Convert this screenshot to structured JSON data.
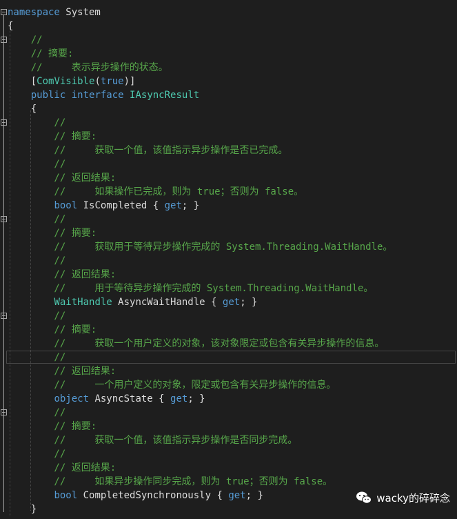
{
  "lines": [
    [
      {
        "t": "namespace",
        "c": "kw"
      },
      {
        "t": " System",
        "c": "pl"
      }
    ],
    [
      {
        "t": "{",
        "c": "pl"
      }
    ],
    [
      {
        "t": "    //",
        "c": "cm"
      }
    ],
    [
      {
        "t": "    // 摘要:",
        "c": "cm"
      }
    ],
    [
      {
        "t": "    //     表示异步操作的状态。",
        "c": "cm"
      }
    ],
    [
      {
        "t": "    [",
        "c": "pl"
      },
      {
        "t": "ComVisible",
        "c": "ty"
      },
      {
        "t": "(",
        "c": "pl"
      },
      {
        "t": "true",
        "c": "kw"
      },
      {
        "t": ")]",
        "c": "pl"
      }
    ],
    [
      {
        "t": "    ",
        "c": "pl"
      },
      {
        "t": "public",
        "c": "kw"
      },
      {
        "t": " ",
        "c": "pl"
      },
      {
        "t": "interface",
        "c": "kw"
      },
      {
        "t": " ",
        "c": "pl"
      },
      {
        "t": "IAsyncResult",
        "c": "ty"
      }
    ],
    [
      {
        "t": "    {",
        "c": "pl"
      }
    ],
    [
      {
        "t": "        //",
        "c": "cm"
      }
    ],
    [
      {
        "t": "        // 摘要:",
        "c": "cm"
      }
    ],
    [
      {
        "t": "        //     获取一个值，该值指示异步操作是否已完成。",
        "c": "cm"
      }
    ],
    [
      {
        "t": "        //",
        "c": "cm"
      }
    ],
    [
      {
        "t": "        // 返回结果:",
        "c": "cm"
      }
    ],
    [
      {
        "t": "        //     如果操作已完成，则为 true；否则为 false。",
        "c": "cm"
      }
    ],
    [
      {
        "t": "        ",
        "c": "pl"
      },
      {
        "t": "bool",
        "c": "kw"
      },
      {
        "t": " IsCompleted { ",
        "c": "pl"
      },
      {
        "t": "get",
        "c": "kw"
      },
      {
        "t": "; }",
        "c": "pl"
      }
    ],
    [
      {
        "t": "        //",
        "c": "cm"
      }
    ],
    [
      {
        "t": "        // 摘要:",
        "c": "cm"
      }
    ],
    [
      {
        "t": "        //     获取用于等待异步操作完成的 System.Threading.WaitHandle。",
        "c": "cm"
      }
    ],
    [
      {
        "t": "        //",
        "c": "cm"
      }
    ],
    [
      {
        "t": "        // 返回结果:",
        "c": "cm"
      }
    ],
    [
      {
        "t": "        //     用于等待异步操作完成的 System.Threading.WaitHandle。",
        "c": "cm"
      }
    ],
    [
      {
        "t": "        ",
        "c": "pl"
      },
      {
        "t": "WaitHandle",
        "c": "ty"
      },
      {
        "t": " AsyncWaitHandle { ",
        "c": "pl"
      },
      {
        "t": "get",
        "c": "kw"
      },
      {
        "t": "; }",
        "c": "pl"
      }
    ],
    [
      {
        "t": "        //",
        "c": "cm"
      }
    ],
    [
      {
        "t": "        // 摘要:",
        "c": "cm"
      }
    ],
    [
      {
        "t": "        //     获取一个用户定义的对象，该对象限定或包含有关异步操作的信息。",
        "c": "cm"
      }
    ],
    [
      {
        "t": "        //",
        "c": "cm"
      }
    ],
    [
      {
        "t": "        // 返回结果:",
        "c": "cm"
      }
    ],
    [
      {
        "t": "        //     一个用户定义的对象，限定或包含有关异步操作的信息。",
        "c": "cm"
      }
    ],
    [
      {
        "t": "        ",
        "c": "pl"
      },
      {
        "t": "object",
        "c": "kw"
      },
      {
        "t": " AsyncState { ",
        "c": "pl"
      },
      {
        "t": "get",
        "c": "kw"
      },
      {
        "t": "; }",
        "c": "pl"
      }
    ],
    [
      {
        "t": "        //",
        "c": "cm"
      }
    ],
    [
      {
        "t": "        // 摘要:",
        "c": "cm"
      }
    ],
    [
      {
        "t": "        //     获取一个值，该值指示异步操作是否同步完成。",
        "c": "cm"
      }
    ],
    [
      {
        "t": "        //",
        "c": "cm"
      }
    ],
    [
      {
        "t": "        // 返回结果:",
        "c": "cm"
      }
    ],
    [
      {
        "t": "        //     如果异步操作同步完成，则为 true；否则为 false。",
        "c": "cm"
      }
    ],
    [
      {
        "t": "        ",
        "c": "pl"
      },
      {
        "t": "bool",
        "c": "kw"
      },
      {
        "t": " CompletedSynchronously { ",
        "c": "pl"
      },
      {
        "t": "get",
        "c": "kw"
      },
      {
        "t": "; }",
        "c": "pl"
      }
    ],
    [
      {
        "t": "    }",
        "c": "pl"
      }
    ]
  ],
  "watermark": {
    "text": "wacky的碎碎念",
    "icon": "wechat-icon"
  },
  "colors": {
    "background": "#1e1e1e",
    "keyword": "#569cd6",
    "type": "#4ec9b0",
    "comment": "#57a64a",
    "plain": "#dcdcdc"
  }
}
